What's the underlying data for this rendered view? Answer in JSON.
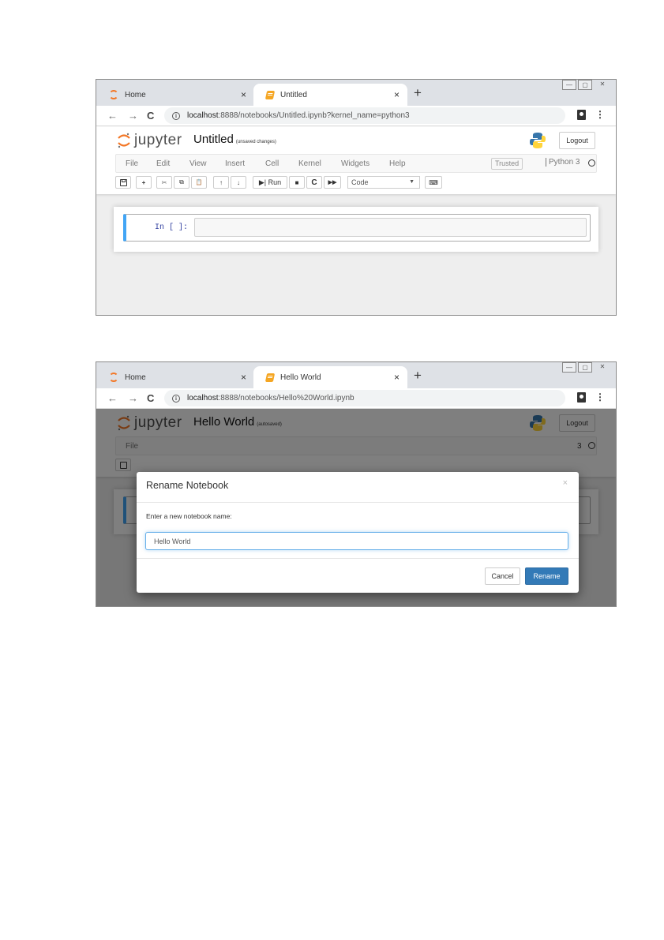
{
  "screenshot1": {
    "tabs": [
      {
        "label": "Home",
        "close": "×"
      },
      {
        "label": "Untitled",
        "close": "×"
      }
    ],
    "new_tab": "+",
    "window_controls": [
      "—",
      "▢",
      "✕"
    ],
    "nav": {
      "back": "←",
      "forward": "→",
      "reload": "C"
    },
    "url_host": "localhost",
    "url_rest": ":8888/notebooks/Untitled.ipynb?kernel_name=python3",
    "brand": "jupyter",
    "notebook_name": "Untitled",
    "save_status": "(unsaved changes)",
    "logout": "Logout",
    "menu": [
      "File",
      "Edit",
      "View",
      "Insert",
      "Cell",
      "Kernel",
      "Widgets",
      "Help"
    ],
    "trusted": "Trusted",
    "kernel": "Python 3",
    "toolbar": {
      "save_icon": "floppy-icon",
      "add_icon": "+",
      "cut_icon": "✂",
      "copy_icon": "⧉",
      "paste_icon": "📋",
      "move_up": "↑",
      "move_down": "↓",
      "run": "▶| Run",
      "stop": "■",
      "restart": "C",
      "run_all": "▶▶",
      "cell_type": "Code",
      "keyboard_icon": "⌨"
    },
    "cell_prompt": "In [ ]:"
  },
  "screenshot2": {
    "tabs": [
      {
        "label": "Home",
        "close": "×"
      },
      {
        "label": "Hello World",
        "close": "×"
      }
    ],
    "new_tab": "+",
    "window_controls": [
      "—",
      "▢",
      "✕"
    ],
    "nav": {
      "back": "←",
      "forward": "→",
      "reload": "C"
    },
    "url_host": "localhost",
    "url_rest": ":8888/notebooks/Hello%20World.ipynb",
    "brand": "jupyter",
    "notebook_name": "Hello World",
    "save_status": "(autosaved)",
    "logout": "Logout",
    "menu_first": "File",
    "kernel_partial": "3",
    "modal": {
      "title": "Rename Notebook",
      "close": "×",
      "label": "Enter a new notebook name:",
      "input_value": "Hello World",
      "cancel": "Cancel",
      "rename": "Rename"
    }
  },
  "colors": {
    "accent_blue": "#337ab7",
    "cell_border": "#42a5f5",
    "jupyter_orange": "#f37726",
    "overlay": "rgba(0,0,0,0.5)"
  }
}
